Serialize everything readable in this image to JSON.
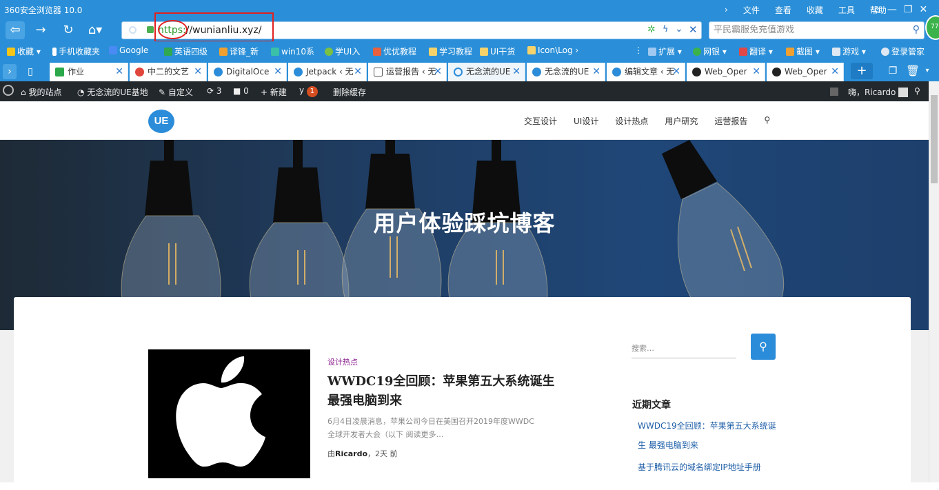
{
  "browser": {
    "title": "360安全浏览器 10.0",
    "menus": [
      "文件",
      "查看",
      "收藏",
      "工具",
      "帮助"
    ],
    "url_scheme": "https:",
    "url_rest": "//wunianliu.xyz/",
    "search_placeholder": "平民霸服免充值游戏",
    "badge_num": "77"
  },
  "favorites": {
    "items": [
      "收藏",
      "手机收藏夹",
      "Google",
      "英语四级",
      "译锋_新",
      "win10系",
      "学UI入",
      "优优教程",
      "学习教程",
      "UI干货",
      "Icon\\Log"
    ],
    "right_items": [
      "扩展",
      "网银",
      "翻译",
      "截图",
      "游戏",
      "登录管家"
    ]
  },
  "tabs": [
    {
      "label": "作业",
      "color": "#2aa84a"
    },
    {
      "label": "中二的文艺",
      "color": "#e0463a"
    },
    {
      "label": "DigitalOce",
      "color": "#2b8cd9"
    },
    {
      "label": "Jetpack ‹ 无",
      "color": "#2b8cd9"
    },
    {
      "label": "运营报告 ‹ 无",
      "color": "#555"
    },
    {
      "label": "无念流的UE",
      "color": "#2b8cd9"
    },
    {
      "label": "无念流的UE",
      "color": "#2b8cd9"
    },
    {
      "label": "编辑文章 ‹ 无",
      "color": "#2b8cd9"
    },
    {
      "label": "Web_Oper",
      "color": "#222"
    },
    {
      "label": "Web_Oper",
      "color": "#222"
    }
  ],
  "wp_admin": {
    "my_sites": "我的站点",
    "site_name": "无念流的UE基地",
    "customize": "自定义",
    "updates": "3",
    "comments": "0",
    "new": "新建",
    "yoast_count": "1",
    "clear_cache": "删除缓存",
    "greeting": "嗨，Ricardo"
  },
  "site": {
    "logo_text": "UE",
    "nav": [
      "交互设计",
      "UI设计",
      "设计热点",
      "用户研究",
      "运营报告"
    ],
    "hero_title": "用户体验踩坑博客"
  },
  "post": {
    "category": "设计热点",
    "title": "WWDC19全回顾：苹果第五大系统诞生 最强电脑到来",
    "excerpt": "6月4日凌晨消息，苹果公司今日在美国召开2019年度WWDC全球开发者大会（以下 阅读更多…",
    "meta_prefix": "由",
    "author": "Ricardo",
    "meta_suffix": "，2天 前"
  },
  "sidebar": {
    "search_placeholder": "搜索…",
    "recent_heading": "近期文章",
    "recent": [
      "WWDC19全回顾：苹果第五大系统诞生 最强电脑到来",
      "基于腾讯云的域名绑定IP地址手册"
    ]
  },
  "colors": {
    "browser_blue": "#2a8fd8",
    "wp_bar": "#23282d",
    "accent": "#2b8cd9",
    "category": "#8a1d8f"
  }
}
